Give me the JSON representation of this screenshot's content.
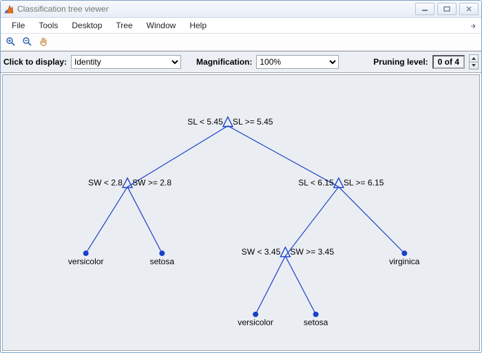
{
  "window": {
    "title": "Classification tree viewer"
  },
  "menu": [
    "File",
    "Tools",
    "Desktop",
    "Tree",
    "Window",
    "Help"
  ],
  "options": {
    "click_label": "Click to display:",
    "click_value": "Identity",
    "mag_label": "Magnification:",
    "mag_value": "100%",
    "prune_label": "Pruning level:",
    "prune_value": "0 of 4"
  },
  "tree": {
    "n0_left_label": "SL < 5.45",
    "n0_right_label": "SL >= 5.45",
    "n1_left_label": "SW < 2.8",
    "n1_right_label": "SW >= 2.8",
    "n2_left_label": "SL < 6.15",
    "n2_right_label": "SL >= 6.15",
    "n3_left_label": "SW < 3.45",
    "n3_right_label": "SW >= 3.45",
    "leaf_versicolor": "versicolor",
    "leaf_setosa": "setosa",
    "leaf_virginica": "virginica",
    "leaf_versicolor2": "versicolor",
    "leaf_setosa2": "setosa"
  }
}
